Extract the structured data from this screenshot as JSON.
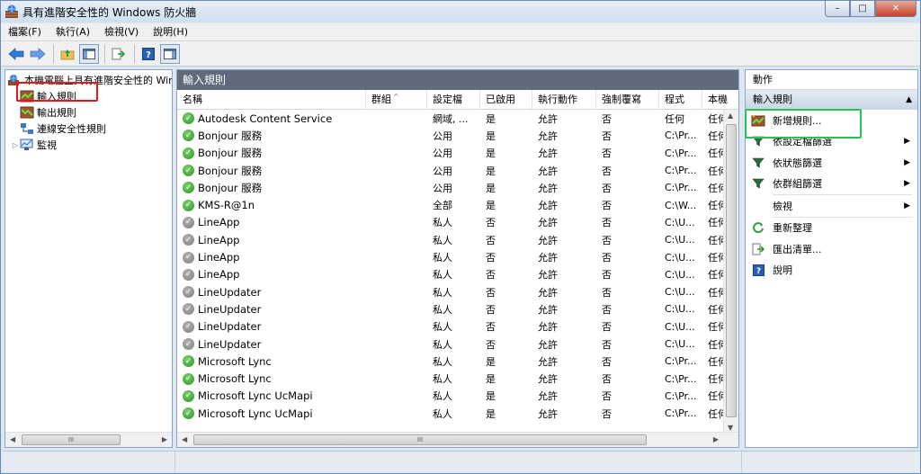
{
  "window": {
    "title": "具有進階安全性的 Windows 防火牆",
    "controls": {
      "minimize": "–",
      "maximize": "□",
      "close": "✕"
    }
  },
  "menu": [
    "檔案(F)",
    "執行(A)",
    "檢視(V)",
    "說明(H)"
  ],
  "tree": {
    "root": "本機電腦上具有進階安全性的 Windows 防火牆",
    "items": [
      "輸入規則",
      "輸出規則",
      "連線安全性規則",
      "監視"
    ]
  },
  "center": {
    "header": "輸入規則",
    "columns": [
      "名稱",
      "群組",
      "設定檔",
      "已啟用",
      "執行動作",
      "強制覆寫",
      "程式",
      "本機"
    ],
    "rows": [
      {
        "name": "Autodesk Content Service",
        "group": "",
        "profile": "網域, ...",
        "enabled": "是",
        "action": "允許",
        "override": "否",
        "program": "任何",
        "local": "任何",
        "on": true
      },
      {
        "name": "Bonjour 服務",
        "group": "",
        "profile": "公用",
        "enabled": "是",
        "action": "允許",
        "override": "否",
        "program": "C:\\Pr...",
        "local": "任何",
        "on": true
      },
      {
        "name": "Bonjour 服務",
        "group": "",
        "profile": "公用",
        "enabled": "是",
        "action": "允許",
        "override": "否",
        "program": "C:\\Pr...",
        "local": "任何",
        "on": true
      },
      {
        "name": "Bonjour 服務",
        "group": "",
        "profile": "公用",
        "enabled": "是",
        "action": "允許",
        "override": "否",
        "program": "C:\\Pr...",
        "local": "任何",
        "on": true
      },
      {
        "name": "Bonjour 服務",
        "group": "",
        "profile": "公用",
        "enabled": "是",
        "action": "允許",
        "override": "否",
        "program": "C:\\Pr...",
        "local": "任何",
        "on": true
      },
      {
        "name": "KMS-R@1n",
        "group": "",
        "profile": "全部",
        "enabled": "是",
        "action": "允許",
        "override": "否",
        "program": "C:\\W...",
        "local": "任何",
        "on": true
      },
      {
        "name": "LineApp",
        "group": "",
        "profile": "私人",
        "enabled": "否",
        "action": "允許",
        "override": "否",
        "program": "C:\\U...",
        "local": "任何",
        "on": false
      },
      {
        "name": "LineApp",
        "group": "",
        "profile": "私人",
        "enabled": "否",
        "action": "允許",
        "override": "否",
        "program": "C:\\U...",
        "local": "任何",
        "on": false
      },
      {
        "name": "LineApp",
        "group": "",
        "profile": "私人",
        "enabled": "否",
        "action": "允許",
        "override": "否",
        "program": "C:\\U...",
        "local": "任何",
        "on": false
      },
      {
        "name": "LineApp",
        "group": "",
        "profile": "私人",
        "enabled": "否",
        "action": "允許",
        "override": "否",
        "program": "C:\\U...",
        "local": "任何",
        "on": false
      },
      {
        "name": "LineUpdater",
        "group": "",
        "profile": "私人",
        "enabled": "否",
        "action": "允許",
        "override": "否",
        "program": "C:\\U...",
        "local": "任何",
        "on": false
      },
      {
        "name": "LineUpdater",
        "group": "",
        "profile": "私人",
        "enabled": "否",
        "action": "允許",
        "override": "否",
        "program": "C:\\U...",
        "local": "任何",
        "on": false
      },
      {
        "name": "LineUpdater",
        "group": "",
        "profile": "私人",
        "enabled": "否",
        "action": "允許",
        "override": "否",
        "program": "C:\\U...",
        "local": "任何",
        "on": false
      },
      {
        "name": "LineUpdater",
        "group": "",
        "profile": "私人",
        "enabled": "否",
        "action": "允許",
        "override": "否",
        "program": "C:\\U...",
        "local": "任何",
        "on": false
      },
      {
        "name": "Microsoft Lync",
        "group": "",
        "profile": "私人",
        "enabled": "是",
        "action": "允許",
        "override": "否",
        "program": "C:\\Pr...",
        "local": "任何",
        "on": true
      },
      {
        "name": "Microsoft Lync",
        "group": "",
        "profile": "私人",
        "enabled": "是",
        "action": "允許",
        "override": "否",
        "program": "C:\\Pr...",
        "local": "任何",
        "on": true
      },
      {
        "name": "Microsoft Lync UcMapi",
        "group": "",
        "profile": "私人",
        "enabled": "是",
        "action": "允許",
        "override": "否",
        "program": "C:\\Pr...",
        "local": "任何",
        "on": true
      },
      {
        "name": "Microsoft Lync UcMapi",
        "group": "",
        "profile": "私人",
        "enabled": "是",
        "action": "允許",
        "override": "否",
        "program": "C:\\Pr...",
        "local": "任何",
        "on": true
      }
    ]
  },
  "actions": {
    "header": "動作",
    "group": "輸入規則",
    "items": [
      {
        "label": "新增規則...",
        "icon": "new-rule-icon",
        "submenu": false
      },
      {
        "label": "依設定檔篩選",
        "icon": "filter-icon",
        "submenu": true
      },
      {
        "label": "依狀態篩選",
        "icon": "filter-icon",
        "submenu": true
      },
      {
        "label": "依群組篩選",
        "icon": "filter-icon",
        "submenu": true
      },
      {
        "label": "檢視",
        "icon": "",
        "submenu": true
      },
      {
        "label": "重新整理",
        "icon": "refresh-icon",
        "submenu": false
      },
      {
        "label": "匯出清單...",
        "icon": "export-icon",
        "submenu": false
      },
      {
        "label": "說明",
        "icon": "help-icon",
        "submenu": false
      }
    ]
  },
  "colors": {
    "header_bg": "#5f6b7b",
    "enabled_icon": "#2a9227",
    "disabled_icon": "#7d7d7d",
    "highlight_red": "#e0191f",
    "highlight_green": "#23c64a"
  }
}
